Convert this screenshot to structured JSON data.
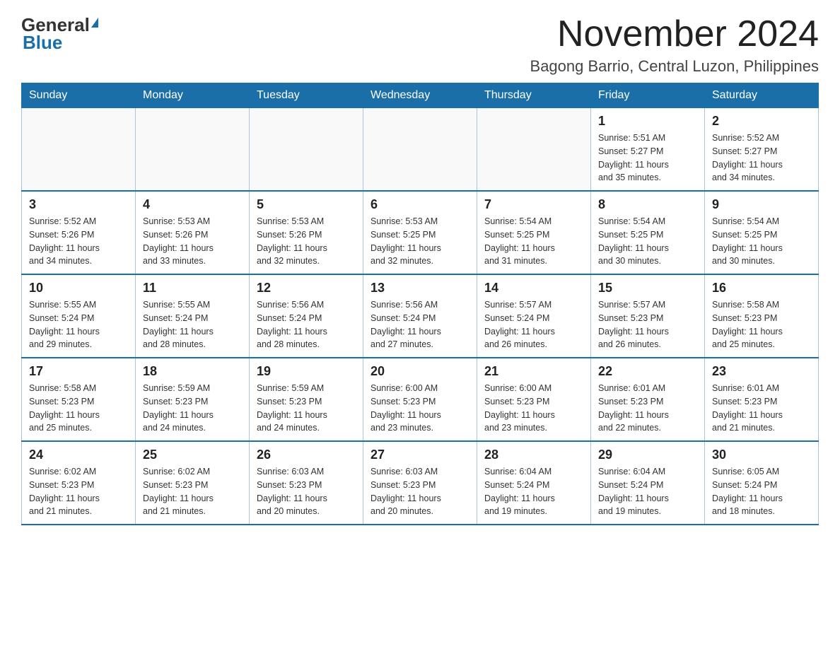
{
  "logo": {
    "general": "General",
    "blue": "Blue"
  },
  "title": "November 2024",
  "subtitle": "Bagong Barrio, Central Luzon, Philippines",
  "weekdays": [
    "Sunday",
    "Monday",
    "Tuesday",
    "Wednesday",
    "Thursday",
    "Friday",
    "Saturday"
  ],
  "weeks": [
    [
      {
        "day": "",
        "info": ""
      },
      {
        "day": "",
        "info": ""
      },
      {
        "day": "",
        "info": ""
      },
      {
        "day": "",
        "info": ""
      },
      {
        "day": "",
        "info": ""
      },
      {
        "day": "1",
        "info": "Sunrise: 5:51 AM\nSunset: 5:27 PM\nDaylight: 11 hours\nand 35 minutes."
      },
      {
        "day": "2",
        "info": "Sunrise: 5:52 AM\nSunset: 5:27 PM\nDaylight: 11 hours\nand 34 minutes."
      }
    ],
    [
      {
        "day": "3",
        "info": "Sunrise: 5:52 AM\nSunset: 5:26 PM\nDaylight: 11 hours\nand 34 minutes."
      },
      {
        "day": "4",
        "info": "Sunrise: 5:53 AM\nSunset: 5:26 PM\nDaylight: 11 hours\nand 33 minutes."
      },
      {
        "day": "5",
        "info": "Sunrise: 5:53 AM\nSunset: 5:26 PM\nDaylight: 11 hours\nand 32 minutes."
      },
      {
        "day": "6",
        "info": "Sunrise: 5:53 AM\nSunset: 5:25 PM\nDaylight: 11 hours\nand 32 minutes."
      },
      {
        "day": "7",
        "info": "Sunrise: 5:54 AM\nSunset: 5:25 PM\nDaylight: 11 hours\nand 31 minutes."
      },
      {
        "day": "8",
        "info": "Sunrise: 5:54 AM\nSunset: 5:25 PM\nDaylight: 11 hours\nand 30 minutes."
      },
      {
        "day": "9",
        "info": "Sunrise: 5:54 AM\nSunset: 5:25 PM\nDaylight: 11 hours\nand 30 minutes."
      }
    ],
    [
      {
        "day": "10",
        "info": "Sunrise: 5:55 AM\nSunset: 5:24 PM\nDaylight: 11 hours\nand 29 minutes."
      },
      {
        "day": "11",
        "info": "Sunrise: 5:55 AM\nSunset: 5:24 PM\nDaylight: 11 hours\nand 28 minutes."
      },
      {
        "day": "12",
        "info": "Sunrise: 5:56 AM\nSunset: 5:24 PM\nDaylight: 11 hours\nand 28 minutes."
      },
      {
        "day": "13",
        "info": "Sunrise: 5:56 AM\nSunset: 5:24 PM\nDaylight: 11 hours\nand 27 minutes."
      },
      {
        "day": "14",
        "info": "Sunrise: 5:57 AM\nSunset: 5:24 PM\nDaylight: 11 hours\nand 26 minutes."
      },
      {
        "day": "15",
        "info": "Sunrise: 5:57 AM\nSunset: 5:23 PM\nDaylight: 11 hours\nand 26 minutes."
      },
      {
        "day": "16",
        "info": "Sunrise: 5:58 AM\nSunset: 5:23 PM\nDaylight: 11 hours\nand 25 minutes."
      }
    ],
    [
      {
        "day": "17",
        "info": "Sunrise: 5:58 AM\nSunset: 5:23 PM\nDaylight: 11 hours\nand 25 minutes."
      },
      {
        "day": "18",
        "info": "Sunrise: 5:59 AM\nSunset: 5:23 PM\nDaylight: 11 hours\nand 24 minutes."
      },
      {
        "day": "19",
        "info": "Sunrise: 5:59 AM\nSunset: 5:23 PM\nDaylight: 11 hours\nand 24 minutes."
      },
      {
        "day": "20",
        "info": "Sunrise: 6:00 AM\nSunset: 5:23 PM\nDaylight: 11 hours\nand 23 minutes."
      },
      {
        "day": "21",
        "info": "Sunrise: 6:00 AM\nSunset: 5:23 PM\nDaylight: 11 hours\nand 23 minutes."
      },
      {
        "day": "22",
        "info": "Sunrise: 6:01 AM\nSunset: 5:23 PM\nDaylight: 11 hours\nand 22 minutes."
      },
      {
        "day": "23",
        "info": "Sunrise: 6:01 AM\nSunset: 5:23 PM\nDaylight: 11 hours\nand 21 minutes."
      }
    ],
    [
      {
        "day": "24",
        "info": "Sunrise: 6:02 AM\nSunset: 5:23 PM\nDaylight: 11 hours\nand 21 minutes."
      },
      {
        "day": "25",
        "info": "Sunrise: 6:02 AM\nSunset: 5:23 PM\nDaylight: 11 hours\nand 21 minutes."
      },
      {
        "day": "26",
        "info": "Sunrise: 6:03 AM\nSunset: 5:23 PM\nDaylight: 11 hours\nand 20 minutes."
      },
      {
        "day": "27",
        "info": "Sunrise: 6:03 AM\nSunset: 5:23 PM\nDaylight: 11 hours\nand 20 minutes."
      },
      {
        "day": "28",
        "info": "Sunrise: 6:04 AM\nSunset: 5:24 PM\nDaylight: 11 hours\nand 19 minutes."
      },
      {
        "day": "29",
        "info": "Sunrise: 6:04 AM\nSunset: 5:24 PM\nDaylight: 11 hours\nand 19 minutes."
      },
      {
        "day": "30",
        "info": "Sunrise: 6:05 AM\nSunset: 5:24 PM\nDaylight: 11 hours\nand 18 minutes."
      }
    ]
  ]
}
